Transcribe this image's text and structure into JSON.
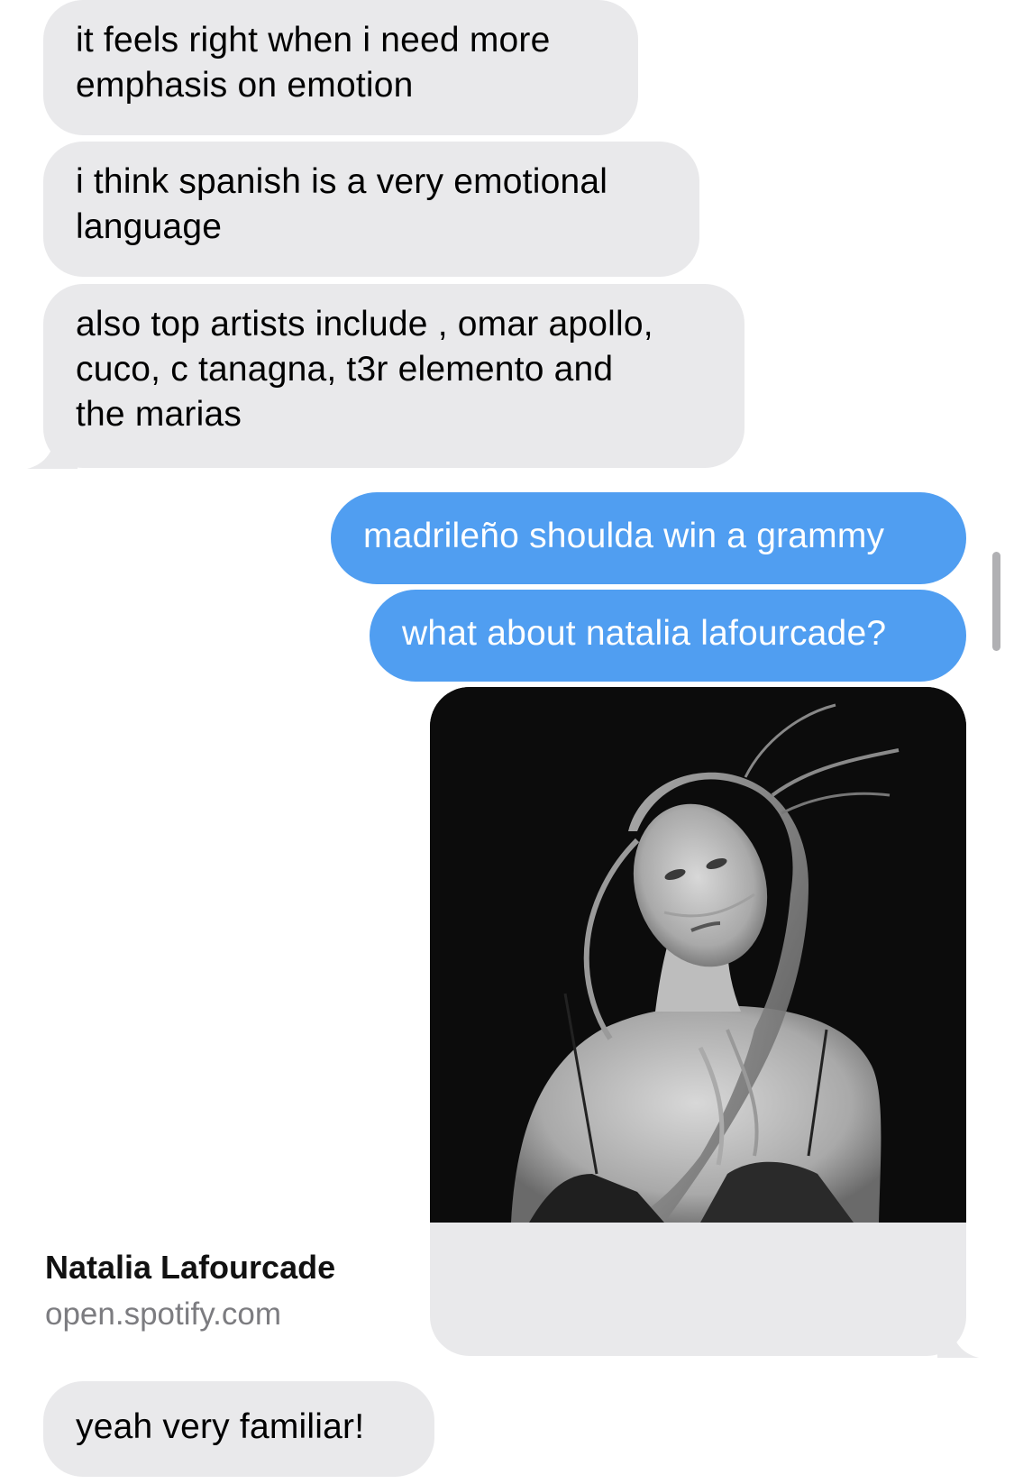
{
  "messages": [
    {
      "direction": "incoming",
      "text": "it feels right when i need more\nemphasis on emotion"
    },
    {
      "direction": "incoming",
      "text": "i think spanish is a very emotional\nlanguage"
    },
    {
      "direction": "incoming",
      "text": "also top artists include , omar apollo,\ncuco, c tanagna, t3r elemento and\nthe marias"
    },
    {
      "direction": "outgoing",
      "text": "madrileño shoulda win a grammy"
    },
    {
      "direction": "outgoing",
      "text": "what about natalia lafourcade?"
    },
    {
      "direction": "incoming",
      "text": "yeah very familiar!"
    }
  ],
  "link_preview": {
    "title": "Natalia Lafourcade",
    "domain": "open.spotify.com",
    "image": "black-and-white-portrait"
  },
  "colors": {
    "incoming_bubble": "#e9e9eb",
    "outgoing_bubble": "#509ef1",
    "incoming_text": "#000000",
    "outgoing_text": "#ffffff",
    "domain_text": "#7c7c80"
  }
}
